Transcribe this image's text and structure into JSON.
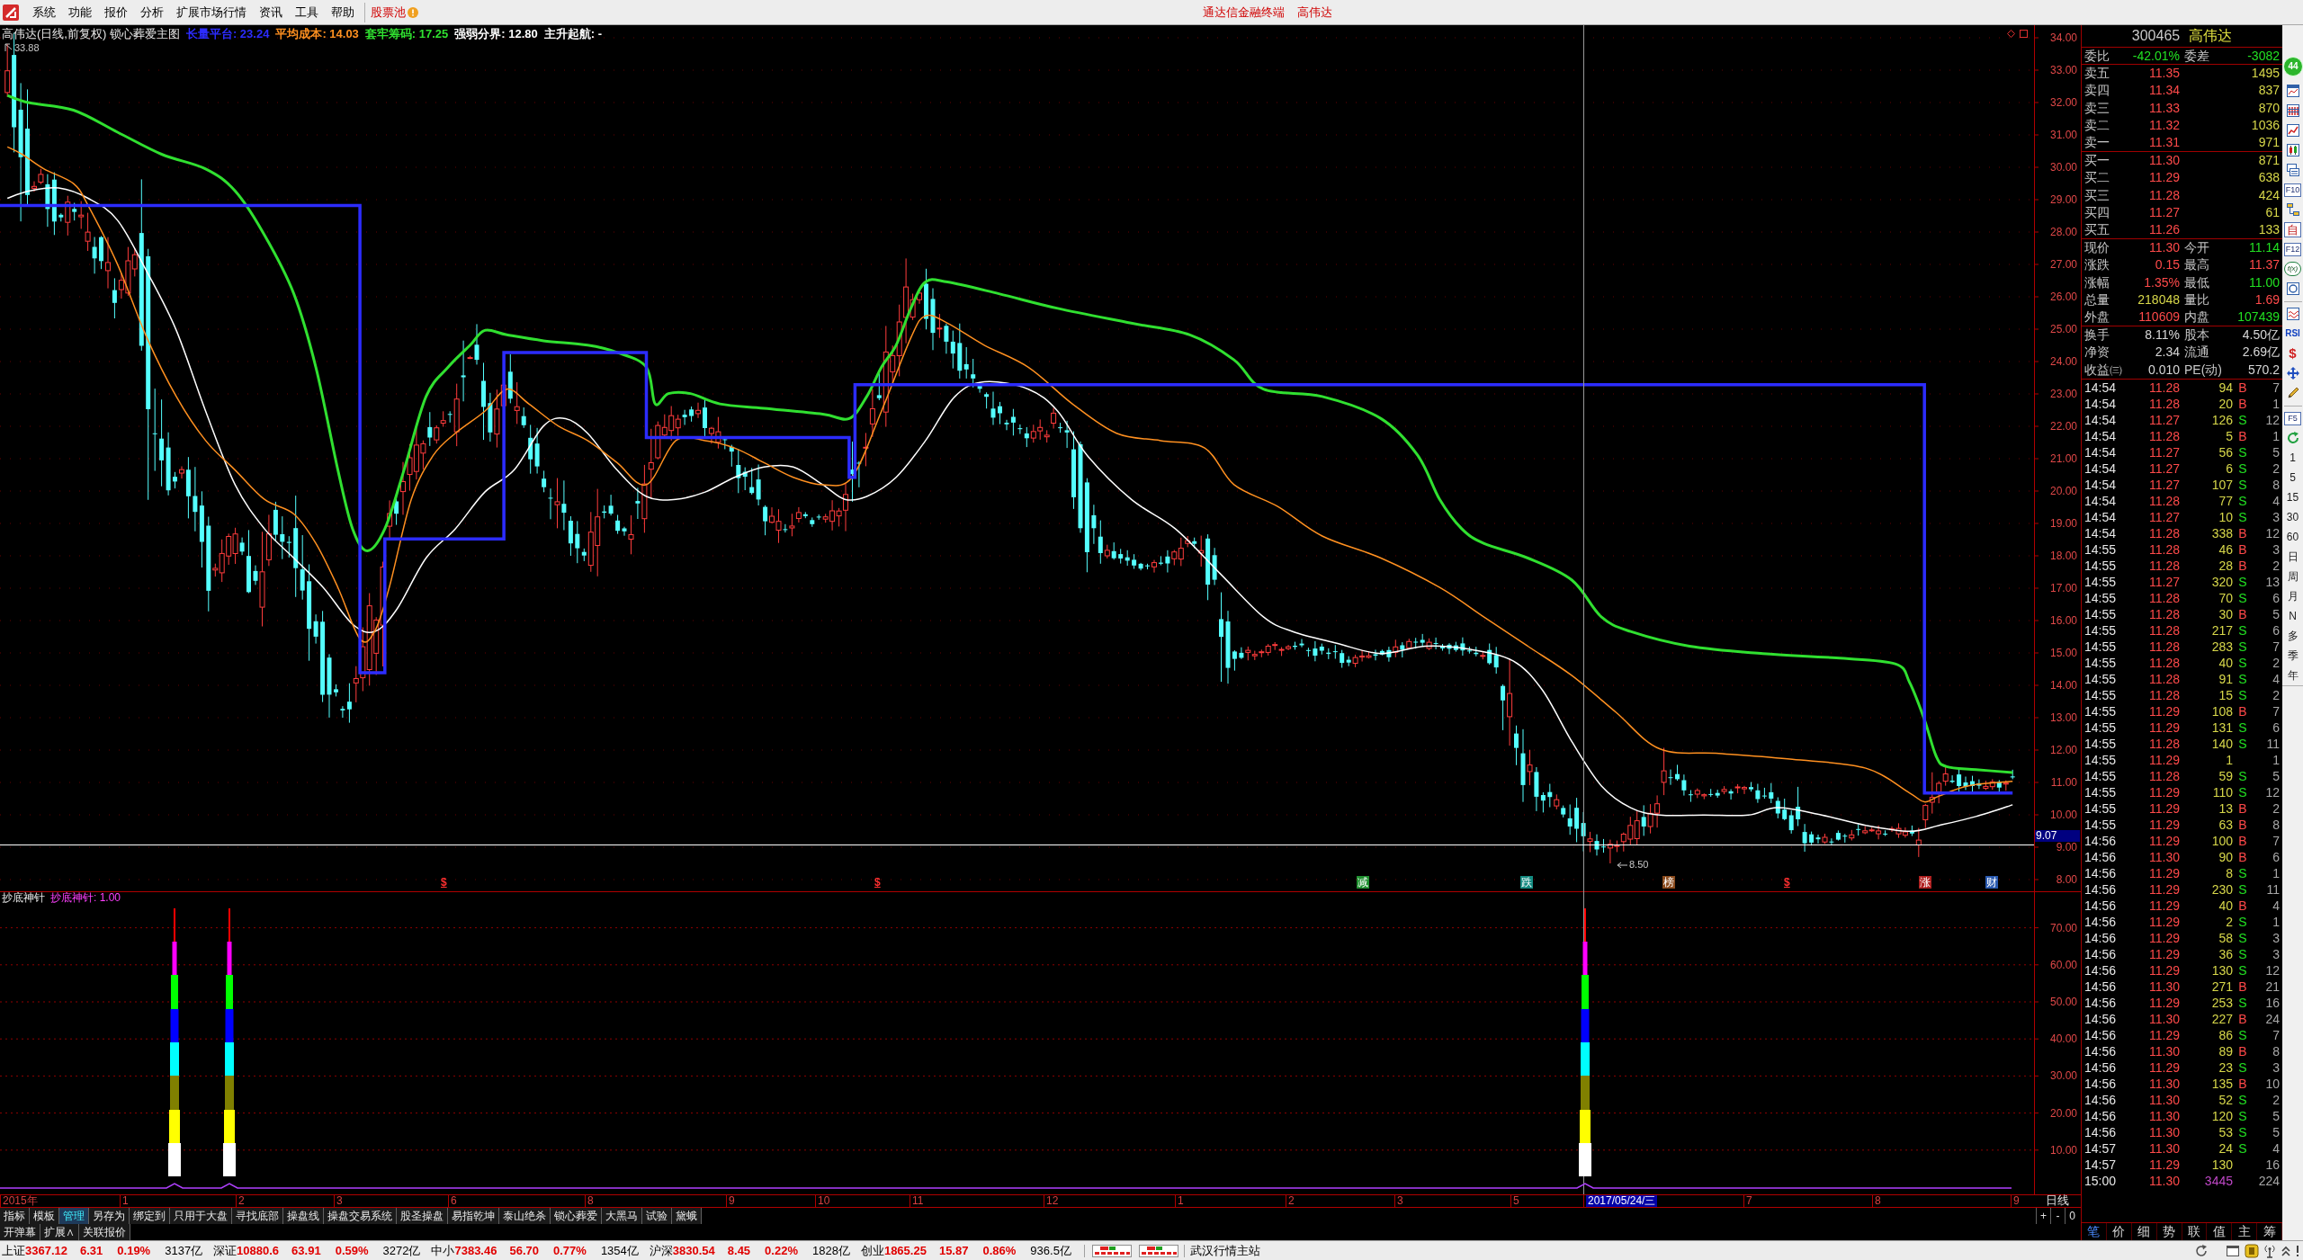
{
  "menu_bar": {
    "items": [
      "系统",
      "功能",
      "报价",
      "分析",
      "扩展市场行情",
      "资讯",
      "工具",
      "帮助"
    ],
    "stock_pool": "股票池",
    "app_title": "通达信金融终端",
    "stock_title": "高伟达"
  },
  "chart": {
    "heading": "高伟达(日线,前复权) 锁心葬爱主图",
    "legend": [
      {
        "label": "长量平台: 23.24",
        "color": "#2c2cff"
      },
      {
        "label": "平均成本: 14.03",
        "color": "#ff9020"
      },
      {
        "label": "套牢筹码: 17.25",
        "color": "#30e030"
      },
      {
        "label": "强弱分界: 12.80",
        "color": "#ffffff"
      },
      {
        "label": "主升起航: -",
        "color": "#ffffff"
      }
    ],
    "high_label": "33.88",
    "low_label": "8.50",
    "price_ticks": [
      "34.00",
      "33.00",
      "32.00",
      "31.00",
      "30.00",
      "29.00",
      "28.00",
      "27.00",
      "26.00",
      "25.00",
      "24.00",
      "23.00",
      "22.00",
      "21.00",
      "20.00",
      "19.00",
      "18.00",
      "17.00",
      "16.00",
      "15.00",
      "14.00",
      "13.00",
      "12.00",
      "11.00",
      "10.00",
      "9.00",
      "8.00"
    ],
    "crosshair_price": "9.07",
    "events": [
      {
        "label": "$",
        "kind": "symbol",
        "color": "#ff3030"
      },
      {
        "label": "$",
        "kind": "symbol",
        "color": "#ff3030"
      },
      {
        "label": "减",
        "kind": "tile",
        "color": "#1f8f2f"
      },
      {
        "label": "跌",
        "kind": "tile",
        "color": "#138a80"
      },
      {
        "label": "榜",
        "kind": "tile",
        "color": "#8a4a1c"
      },
      {
        "label": "$",
        "kind": "symbol",
        "color": "#ff3030"
      },
      {
        "label": "涨",
        "kind": "tile",
        "color": "#b02020"
      },
      {
        "label": "财",
        "kind": "tile",
        "color": "#2a5ab0"
      }
    ]
  },
  "indicator": {
    "name": "抄底神针",
    "reading": "抄底神针: 1.00",
    "ticks": [
      "70.00",
      "60.00",
      "50.00",
      "40.00",
      "30.00",
      "20.00",
      "10.00"
    ]
  },
  "date_axis": {
    "labels": [
      {
        "text": "2015年",
        "kind": "tick"
      },
      {
        "text": "1",
        "kind": "tick"
      },
      {
        "text": "2",
        "kind": "tick"
      },
      {
        "text": "3",
        "kind": "tick"
      },
      {
        "text": "6",
        "kind": "tick"
      },
      {
        "text": "8",
        "kind": "tick"
      },
      {
        "text": "9",
        "kind": "tick"
      },
      {
        "text": "10",
        "kind": "tick"
      },
      {
        "text": "11",
        "kind": "tick"
      },
      {
        "text": "12",
        "kind": "tick"
      },
      {
        "text": "1",
        "kind": "tick"
      },
      {
        "text": "2",
        "kind": "tick"
      },
      {
        "text": "3",
        "kind": "tick"
      },
      {
        "text": "5",
        "kind": "tick"
      },
      {
        "text": "2017/05/24/三",
        "kind": "cursor"
      },
      {
        "text": "7",
        "kind": "tick"
      },
      {
        "text": "8",
        "kind": "tick"
      },
      {
        "text": "9",
        "kind": "tick"
      }
    ],
    "period": "日线",
    "zoom_buttons": [
      "+",
      "-",
      "0"
    ]
  },
  "indicator_tabs": [
    {
      "label": "指标",
      "selected": false
    },
    {
      "label": "模板",
      "selected": false
    },
    {
      "label": "管理",
      "selected": true
    },
    {
      "label": "另存为",
      "selected": false
    },
    {
      "label": "绑定到",
      "selected": false
    },
    {
      "label": "只用于大盘",
      "selected": false
    },
    {
      "label": "寻找底部",
      "selected": false
    },
    {
      "label": "操盘线",
      "selected": false
    },
    {
      "label": "操盘交易系统",
      "selected": false
    },
    {
      "label": "股圣操盘",
      "selected": false
    },
    {
      "label": "易指乾坤",
      "selected": false
    },
    {
      "label": "泰山绝杀",
      "selected": false
    },
    {
      "label": "锁心葬爱",
      "selected": false
    },
    {
      "label": "大黑马",
      "selected": false
    },
    {
      "label": "试验",
      "selected": false
    },
    {
      "label": "黛蛾",
      "selected": false
    }
  ],
  "bottom_buttons": [
    "开弹幕",
    "扩展∧",
    "关联报价"
  ],
  "quote_panel": {
    "header": {
      "code": "300465",
      "name": "高伟达"
    },
    "ratio": [
      {
        "label": "委比",
        "value": "-42.01%",
        "color": "#22e022"
      },
      {
        "label": "委差",
        "value": "-3082",
        "color": "#22e022"
      }
    ],
    "asks": [
      {
        "label": "卖五",
        "price": "11.35",
        "volume": "1495"
      },
      {
        "label": "卖四",
        "price": "11.34",
        "volume": "837"
      },
      {
        "label": "卖三",
        "price": "11.33",
        "volume": "870"
      },
      {
        "label": "卖二",
        "price": "11.32",
        "volume": "1036"
      },
      {
        "label": "卖一",
        "price": "11.31",
        "volume": "971"
      }
    ],
    "bids": [
      {
        "label": "买一",
        "price": "11.30",
        "volume": "871"
      },
      {
        "label": "买二",
        "price": "11.29",
        "volume": "638"
      },
      {
        "label": "买三",
        "price": "11.28",
        "volume": "424"
      },
      {
        "label": "买四",
        "price": "11.27",
        "volume": "61"
      },
      {
        "label": "买五",
        "price": "11.26",
        "volume": "133"
      }
    ],
    "stats": [
      {
        "label": "现价",
        "value": "11.30",
        "color": "#ff4a4a"
      },
      {
        "label": "今开",
        "value": "11.14",
        "color": "#22e022"
      },
      {
        "label": "涨跌",
        "value": "0.15",
        "color": "#ff4a4a"
      },
      {
        "label": "最高",
        "value": "11.37",
        "color": "#ff4a4a"
      },
      {
        "label": "涨幅",
        "value": "1.35%",
        "color": "#ff4a4a"
      },
      {
        "label": "最低",
        "value": "11.00",
        "color": "#22e022"
      },
      {
        "label": "总量",
        "value": "218048",
        "color": "#d8d84a"
      },
      {
        "label": "量比",
        "value": "1.69",
        "color": "#ff4a4a"
      },
      {
        "label": "外盘",
        "value": "110609",
        "color": "#ff4a4a"
      },
      {
        "label": "内盘",
        "value": "107439",
        "color": "#22e022"
      }
    ],
    "fundamentals": [
      {
        "label": "换手",
        "value": "8.11%"
      },
      {
        "label": "股本",
        "value": "4.50亿"
      },
      {
        "label": "净资",
        "value": "2.34"
      },
      {
        "label": "流通",
        "value": "2.69亿"
      },
      {
        "label": "收益㈢",
        "value": "0.010"
      },
      {
        "label": "PE(动)",
        "value": "570.2"
      }
    ],
    "ticks": [
      {
        "time": "14:54",
        "price": "11.28",
        "volume": "94",
        "side": "B",
        "count": "7",
        "kind": "buy"
      },
      {
        "time": "14:54",
        "price": "11.28",
        "volume": "20",
        "side": "B",
        "count": "1",
        "kind": "buy"
      },
      {
        "time": "14:54",
        "price": "11.27",
        "volume": "126",
        "side": "S",
        "count": "12",
        "kind": "sell"
      },
      {
        "time": "14:54",
        "price": "11.28",
        "volume": "5",
        "side": "B",
        "count": "1",
        "kind": "buy"
      },
      {
        "time": "14:54",
        "price": "11.27",
        "volume": "56",
        "side": "S",
        "count": "5",
        "kind": "sell"
      },
      {
        "time": "14:54",
        "price": "11.27",
        "volume": "6",
        "side": "S",
        "count": "2",
        "kind": "sell"
      },
      {
        "time": "14:54",
        "price": "11.27",
        "volume": "107",
        "side": "S",
        "count": "8",
        "kind": "sell"
      },
      {
        "time": "14:54",
        "price": "11.28",
        "volume": "77",
        "side": "S",
        "count": "4",
        "kind": "sell"
      },
      {
        "time": "14:54",
        "price": "11.27",
        "volume": "10",
        "side": "S",
        "count": "3",
        "kind": "sell"
      },
      {
        "time": "14:54",
        "price": "11.28",
        "volume": "338",
        "side": "B",
        "count": "12",
        "kind": "buy"
      },
      {
        "time": "14:55",
        "price": "11.28",
        "volume": "46",
        "side": "B",
        "count": "3",
        "kind": "buy"
      },
      {
        "time": "14:55",
        "price": "11.28",
        "volume": "28",
        "side": "B",
        "count": "2",
        "kind": "buy"
      },
      {
        "time": "14:55",
        "price": "11.27",
        "volume": "320",
        "side": "S",
        "count": "13",
        "kind": "sell"
      },
      {
        "time": "14:55",
        "price": "11.28",
        "volume": "70",
        "side": "S",
        "count": "6",
        "kind": "sell"
      },
      {
        "time": "14:55",
        "price": "11.28",
        "volume": "30",
        "side": "B",
        "count": "5",
        "kind": "buy"
      },
      {
        "time": "14:55",
        "price": "11.28",
        "volume": "217",
        "side": "S",
        "count": "6",
        "kind": "sell"
      },
      {
        "time": "14:55",
        "price": "11.28",
        "volume": "283",
        "side": "S",
        "count": "7",
        "kind": "sell"
      },
      {
        "time": "14:55",
        "price": "11.28",
        "volume": "40",
        "side": "S",
        "count": "2",
        "kind": "sell"
      },
      {
        "time": "14:55",
        "price": "11.28",
        "volume": "91",
        "side": "S",
        "count": "4",
        "kind": "sell"
      },
      {
        "time": "14:55",
        "price": "11.28",
        "volume": "15",
        "side": "S",
        "count": "2",
        "kind": "sell"
      },
      {
        "time": "14:55",
        "price": "11.29",
        "volume": "108",
        "side": "B",
        "count": "7",
        "kind": "buy"
      },
      {
        "time": "14:55",
        "price": "11.29",
        "volume": "131",
        "side": "S",
        "count": "6",
        "kind": "sell"
      },
      {
        "time": "14:55",
        "price": "11.28",
        "volume": "140",
        "side": "S",
        "count": "11",
        "kind": "sell"
      },
      {
        "time": "14:55",
        "price": "11.29",
        "volume": "1",
        "count": "1",
        "kind": "none"
      },
      {
        "time": "14:55",
        "price": "11.28",
        "volume": "59",
        "side": "S",
        "count": "5",
        "kind": "sell"
      },
      {
        "time": "14:55",
        "price": "11.29",
        "volume": "110",
        "side": "S",
        "count": "12",
        "kind": "sell"
      },
      {
        "time": "14:55",
        "price": "11.29",
        "volume": "13",
        "side": "B",
        "count": "2",
        "kind": "buy"
      },
      {
        "time": "14:55",
        "price": "11.29",
        "volume": "63",
        "side": "B",
        "count": "8",
        "kind": "buy"
      },
      {
        "time": "14:56",
        "price": "11.29",
        "volume": "100",
        "side": "B",
        "count": "7",
        "kind": "buy"
      },
      {
        "time": "14:56",
        "price": "11.30",
        "volume": "90",
        "side": "B",
        "count": "6",
        "kind": "buy"
      },
      {
        "time": "14:56",
        "price": "11.29",
        "volume": "8",
        "side": "S",
        "count": "1",
        "kind": "sell"
      },
      {
        "time": "14:56",
        "price": "11.29",
        "volume": "230",
        "side": "S",
        "count": "11",
        "kind": "sell"
      },
      {
        "time": "14:56",
        "price": "11.29",
        "volume": "40",
        "side": "B",
        "count": "4",
        "kind": "buy"
      },
      {
        "time": "14:56",
        "price": "11.29",
        "volume": "2",
        "side": "S",
        "count": "1",
        "kind": "sell"
      },
      {
        "time": "14:56",
        "price": "11.29",
        "volume": "58",
        "side": "S",
        "count": "3",
        "kind": "sell"
      },
      {
        "time": "14:56",
        "price": "11.29",
        "volume": "36",
        "side": "S",
        "count": "3",
        "kind": "sell"
      },
      {
        "time": "14:56",
        "price": "11.29",
        "volume": "130",
        "side": "S",
        "count": "12",
        "kind": "sell"
      },
      {
        "time": "14:56",
        "price": "11.30",
        "volume": "271",
        "side": "B",
        "count": "21",
        "kind": "buy"
      },
      {
        "time": "14:56",
        "price": "11.29",
        "volume": "253",
        "side": "S",
        "count": "16",
        "kind": "sell"
      },
      {
        "time": "14:56",
        "price": "11.30",
        "volume": "227",
        "side": "B",
        "count": "24",
        "kind": "buy"
      },
      {
        "time": "14:56",
        "price": "11.29",
        "volume": "86",
        "side": "S",
        "count": "7",
        "kind": "sell"
      },
      {
        "time": "14:56",
        "price": "11.30",
        "volume": "89",
        "side": "B",
        "count": "8",
        "kind": "buy"
      },
      {
        "time": "14:56",
        "price": "11.29",
        "volume": "23",
        "side": "S",
        "count": "3",
        "kind": "sell"
      },
      {
        "time": "14:56",
        "price": "11.30",
        "volume": "135",
        "side": "B",
        "count": "10",
        "kind": "buy"
      },
      {
        "time": "14:56",
        "price": "11.30",
        "volume": "52",
        "side": "S",
        "count": "2",
        "kind": "sell"
      },
      {
        "time": "14:56",
        "price": "11.30",
        "volume": "120",
        "side": "S",
        "count": "5",
        "kind": "sell"
      },
      {
        "time": "14:56",
        "price": "11.30",
        "volume": "53",
        "side": "S",
        "count": "5",
        "kind": "sell"
      },
      {
        "time": "14:57",
        "price": "11.30",
        "volume": "24",
        "side": "S",
        "count": "4",
        "kind": "sell"
      },
      {
        "time": "14:57",
        "price": "11.29",
        "volume": "130",
        "count": "16",
        "kind": "none"
      },
      {
        "time": "15:00",
        "price": "11.30",
        "volume": "3445",
        "count": "224",
        "kind": "auction"
      }
    ],
    "tabs": [
      {
        "label": "笔",
        "selected": true
      },
      {
        "label": "价",
        "selected": false
      },
      {
        "label": "细",
        "selected": false
      },
      {
        "label": "势",
        "selected": false
      },
      {
        "label": "联",
        "selected": false
      },
      {
        "label": "值",
        "selected": false
      },
      {
        "label": "主",
        "selected": false
      },
      {
        "label": "筹",
        "selected": false
      }
    ]
  },
  "side_toolbar": {
    "badge": "44",
    "labels": [
      "F10",
      "自",
      "F12",
      "f(x)",
      "RSI",
      "$",
      "F5"
    ],
    "periods": [
      "1",
      "5",
      "15",
      "30",
      "60",
      "日",
      "周",
      "月",
      "N",
      "多",
      "季",
      "年"
    ]
  },
  "status_bar": {
    "indices": [
      {
        "name": "上证",
        "value": "3367.12",
        "change": "6.31",
        "percent": "0.19%",
        "amount": "3137亿"
      },
      {
        "name": "深证",
        "value": "10880.6",
        "change": "63.91",
        "percent": "0.59%",
        "amount": "3272亿"
      },
      {
        "name": "中小",
        "value": "7383.46",
        "change": "56.70",
        "percent": "0.77%",
        "amount": "1354亿"
      },
      {
        "name": "沪深",
        "value": "3830.54",
        "change": "8.45",
        "percent": "0.22%",
        "amount": "1828亿"
      },
      {
        "name": "创业",
        "value": "1865.25",
        "change": "15.87",
        "percent": "0.86%",
        "amount": "936.5亿"
      }
    ],
    "server": "武汉行情主站"
  }
}
